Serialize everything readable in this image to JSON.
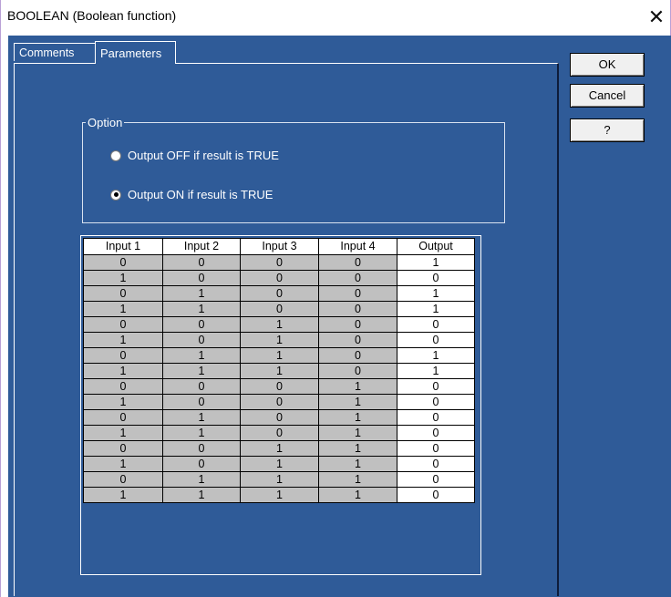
{
  "window": {
    "title": "BOOLEAN (Boolean function)",
    "close_glyph": "✕"
  },
  "tabs": [
    {
      "label": "Comments",
      "active": false
    },
    {
      "label": "Parameters",
      "active": true
    }
  ],
  "buttons": {
    "ok": "OK",
    "cancel": "Cancel",
    "help": "?"
  },
  "option_group": {
    "legend": "Option",
    "options": [
      {
        "label": "Output OFF if result is TRUE",
        "checked": false
      },
      {
        "label": "Output ON if result is TRUE",
        "checked": true
      }
    ]
  },
  "truth_table": {
    "headers": [
      "Input 1",
      "Input 2",
      "Input 3",
      "Input 4",
      "Output"
    ],
    "rows": [
      [
        "0",
        "0",
        "0",
        "0",
        "1"
      ],
      [
        "1",
        "0",
        "0",
        "0",
        "0"
      ],
      [
        "0",
        "1",
        "0",
        "0",
        "1"
      ],
      [
        "1",
        "1",
        "0",
        "0",
        "1"
      ],
      [
        "0",
        "0",
        "1",
        "0",
        "0"
      ],
      [
        "1",
        "0",
        "1",
        "0",
        "0"
      ],
      [
        "0",
        "1",
        "1",
        "0",
        "1"
      ],
      [
        "1",
        "1",
        "1",
        "0",
        "1"
      ],
      [
        "0",
        "0",
        "0",
        "1",
        "0"
      ],
      [
        "1",
        "0",
        "0",
        "1",
        "0"
      ],
      [
        "0",
        "1",
        "0",
        "1",
        "0"
      ],
      [
        "1",
        "1",
        "0",
        "1",
        "0"
      ],
      [
        "0",
        "0",
        "1",
        "1",
        "0"
      ],
      [
        "1",
        "0",
        "1",
        "1",
        "0"
      ],
      [
        "0",
        "1",
        "1",
        "1",
        "0"
      ],
      [
        "1",
        "1",
        "1",
        "1",
        "0"
      ]
    ]
  },
  "colors": {
    "panel_background": "#2f5b98",
    "input_cell": "#c0c0c0",
    "output_cell": "#ffffff"
  }
}
